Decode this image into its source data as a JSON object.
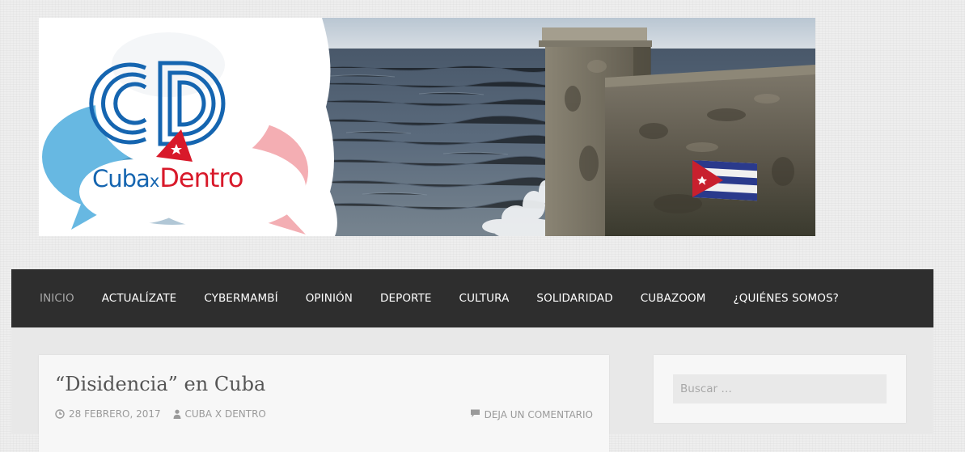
{
  "header": {
    "logo": {
      "initials": "CD",
      "brand_left": "Cuba",
      "brand_mid": "x",
      "brand_right": "Dentro",
      "colors": {
        "blue": "#1565b0",
        "red": "#d8192a",
        "light_blue": "#5bb3e0",
        "pink": "#f2a0a6"
      }
    },
    "flag_colors": {
      "stripe_blue": "#2a3a8c",
      "triangle_red": "#c8202e",
      "white": "#ffffff"
    }
  },
  "nav": {
    "items": [
      {
        "label": "INICIO",
        "active": true
      },
      {
        "label": "ACTUALÍZATE",
        "active": false
      },
      {
        "label": "CYBERMAMBÍ",
        "active": false
      },
      {
        "label": "OPINIÓN",
        "active": false
      },
      {
        "label": "DEPORTE",
        "active": false
      },
      {
        "label": "CULTURA",
        "active": false
      },
      {
        "label": "SOLIDARIDAD",
        "active": false
      },
      {
        "label": "CUBAZOOM",
        "active": false
      },
      {
        "label": "¿QUIÉNES SOMOS?",
        "active": false
      }
    ]
  },
  "post": {
    "title": "“Disidencia” en Cuba",
    "date": "28 FEBRERO, 2017",
    "author": "CUBA X DENTRO",
    "comments_link": "DEJA UN COMENTARIO",
    "icons": {
      "date": "clock-icon",
      "author": "user-icon",
      "comments": "comment-icon"
    }
  },
  "sidebar": {
    "search_placeholder": "Buscar …"
  }
}
